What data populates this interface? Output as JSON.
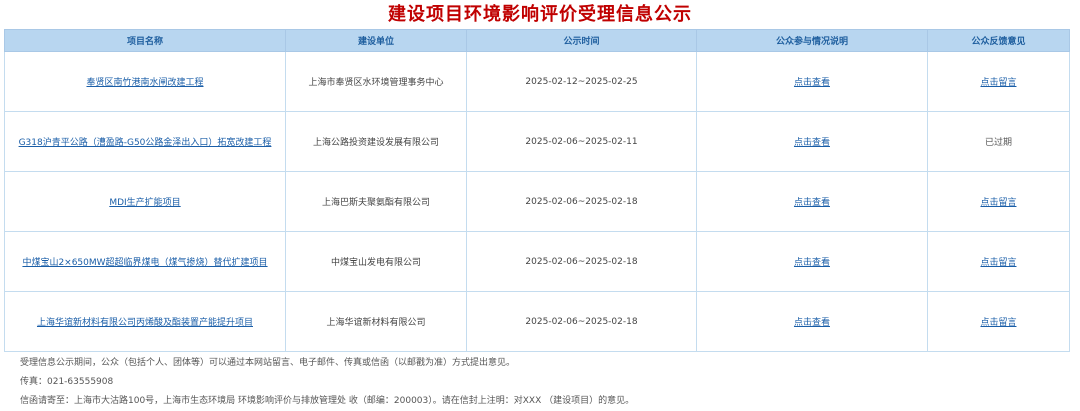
{
  "page": {
    "title": "建设项目环境影响评价受理信息公示"
  },
  "table": {
    "headers": [
      "项目名称",
      "建设单位",
      "公示时间",
      "公众参与情况说明",
      "公众反馈意见"
    ],
    "rows": [
      {
        "project": "奉贤区南竹港南水闸改建工程",
        "unit": "上海市奉贤区水环境管理事务中心",
        "period": "2025-02-12~2025-02-25",
        "participation": "点击查看",
        "feedback": "点击留言",
        "feedback_link": true
      },
      {
        "project": "G318沪青平公路（漕盈路-G50公路金泽出入口）拓宽改建工程",
        "unit": "上海公路投资建设发展有限公司",
        "period": "2025-02-06~2025-02-11",
        "participation": "点击查看",
        "feedback": "已过期",
        "feedback_link": false
      },
      {
        "project": "MDI生产扩能项目",
        "unit": "上海巴斯夫聚氨酯有限公司",
        "period": "2025-02-06~2025-02-18",
        "participation": "点击查看",
        "feedback": "点击留言",
        "feedback_link": true
      },
      {
        "project": "中煤宝山2×650MW超超临界煤电（煤气掺烧）替代扩建项目",
        "unit": "中煤宝山发电有限公司",
        "period": "2025-02-06~2025-02-18",
        "participation": "点击查看",
        "feedback": "点击留言",
        "feedback_link": true
      },
      {
        "project": "上海华谊新材料有限公司丙烯酸及酯装置产能提升项目",
        "unit": "上海华谊新材料有限公司",
        "period": "2025-02-06~2025-02-18",
        "participation": "点击查看",
        "feedback": "点击留言",
        "feedback_link": true
      }
    ]
  },
  "notes": {
    "line1": "受理信息公示期间，公众（包括个人、团体等）可以通过本网站留言、电子邮件、传真或信函（以邮戳为准）方式提出意见。",
    "line2": "传真：021-63555908",
    "line3": "信函请寄至：上海市大沽路100号，上海市生态环境局 环境影响评价与排放管理处 收（邮编：200003）。请在信封上注明：对XXX （建设项目）的意见。"
  }
}
